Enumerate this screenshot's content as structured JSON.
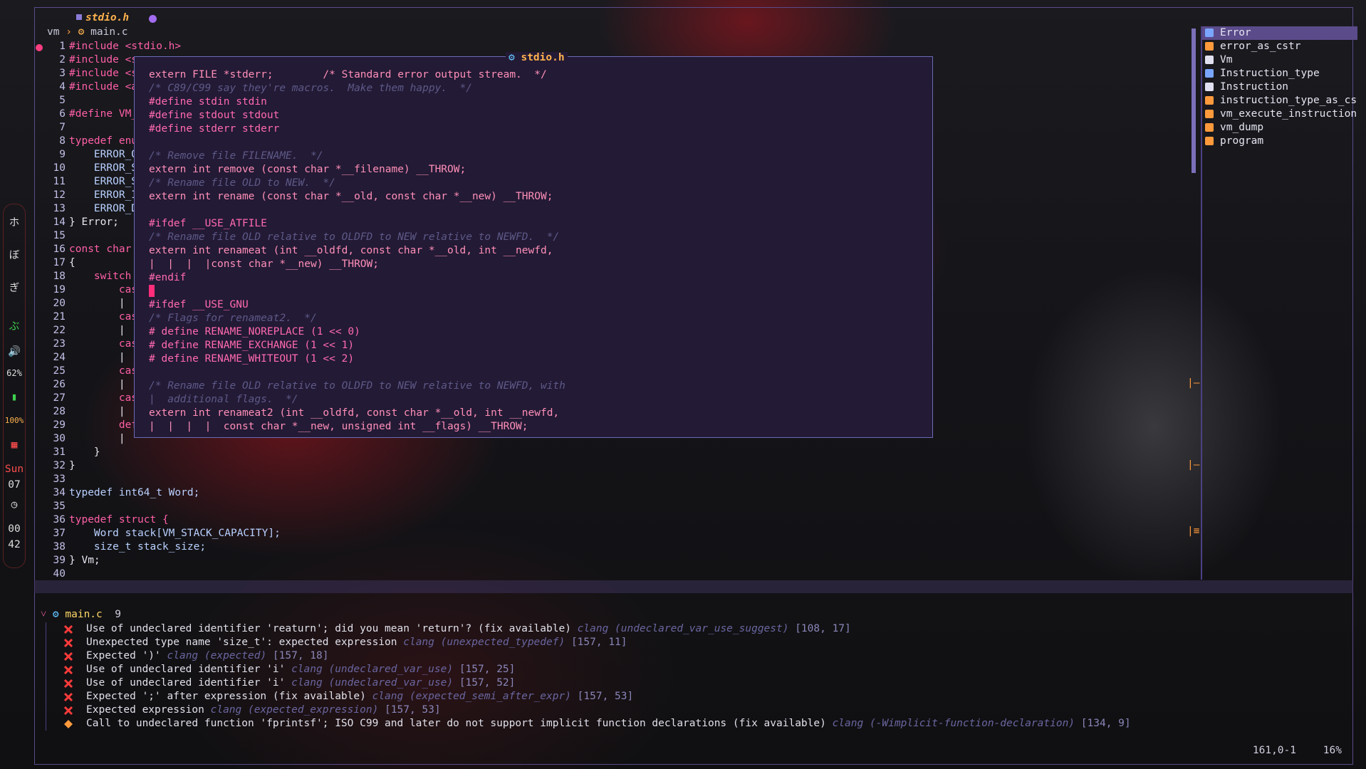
{
  "tabline": {
    "active_tab": "stdio.h"
  },
  "breadcrumb": {
    "root": "vm",
    "file": "main.c"
  },
  "editor": {
    "line_numbers": [
      "1",
      "2",
      "3",
      "4",
      "5",
      "6",
      "7",
      "8",
      "9",
      "10",
      "11",
      "12",
      "13",
      "14",
      "15",
      "16",
      "17",
      "18",
      "19",
      "20",
      "21",
      "22",
      "23",
      "24",
      "25",
      "26",
      "27",
      "28",
      "29",
      "30",
      "31",
      "32",
      "33",
      "34",
      "35",
      "36",
      "37",
      "38",
      "39",
      "40"
    ],
    "lines": [
      "#include <stdio.h>",
      "#include <s",
      "#include <s",
      "#include <a",
      "",
      "#define VM_",
      "",
      "typedef enu",
      "    ERROR_O",
      "    ERROR_S",
      "    ERROR_S",
      "    ERROR_I",
      "    ERROR_D",
      "} Error;",
      "",
      "const char",
      "{",
      "    switch",
      "        cas",
      "        |",
      "        cas",
      "        |",
      "        cas",
      "        |",
      "        cas",
      "        |",
      "        cas",
      "        |",
      "        def",
      "        |",
      "    }",
      "}",
      "",
      "typedef int64_t Word;",
      "",
      "typedef struct {",
      "    Word stack[VM_STACK_CAPACITY];",
      "    size_t stack_size;",
      "} Vm;",
      ""
    ]
  },
  "float": {
    "title": "stdio.h",
    "lines": [
      "extern FILE *stderr;        /* Standard error output stream.  */",
      "/* C89/C99 say they're macros.  Make them happy.  */",
      "#define stdin stdin",
      "#define stdout stdout",
      "#define stderr stderr",
      "",
      "/* Remove file FILENAME.  */",
      "extern int remove (const char *__filename) __THROW;",
      "/* Rename file OLD to NEW.  */",
      "extern int rename (const char *__old, const char *__new) __THROW;",
      "",
      "#ifdef __USE_ATFILE",
      "/* Rename file OLD relative to OLDFD to NEW relative to NEWFD.  */",
      "extern int renameat (int __oldfd, const char *__old, int __newfd,",
      "|  |  |  |const char *__new) __THROW;",
      "#endif",
      "",
      "#ifdef __USE_GNU",
      "/* Flags for renameat2.  */",
      "# define RENAME_NOREPLACE (1 << 0)",
      "# define RENAME_EXCHANGE (1 << 1)",
      "# define RENAME_WHITEOUT (1 << 2)",
      "",
      "/* Rename file OLD relative to OLDFD to NEW relative to NEWFD, with",
      "|  additional flags.  */",
      "extern int renameat2 (int __oldfd, const char *__old, int __newfd,",
      "|  |  |  |  const char *__new, unsigned int __flags) __THROW;"
    ]
  },
  "rail": {
    "items": [
      "ホ",
      "ぼ",
      "ぎ",
      "ぶ"
    ],
    "volume": "62%",
    "battery": "100%",
    "day": "Sun",
    "date": "07",
    "hour": "00",
    "minute": "42"
  },
  "outline": {
    "items": [
      {
        "label": "Error",
        "icon": "enum-icon",
        "color": "#7aa6ff"
      },
      {
        "label": "error_as_cstr",
        "icon": "function-icon",
        "color": "#ff9a3c"
      },
      {
        "label": "Vm",
        "icon": "struct-icon",
        "color": "#e0e0f0"
      },
      {
        "label": "Instruction_type",
        "icon": "enum-icon",
        "color": "#7aa6ff"
      },
      {
        "label": "Instruction",
        "icon": "struct-icon",
        "color": "#e0e0f0"
      },
      {
        "label": "instruction_type_as_cstr",
        "icon": "function-icon",
        "color": "#ff9a3c"
      },
      {
        "label": "vm_execute_instruction",
        "icon": "function-icon",
        "color": "#ff9a3c"
      },
      {
        "label": "vm_dump",
        "icon": "function-icon",
        "color": "#ff9a3c"
      },
      {
        "label": "program",
        "icon": "function-icon",
        "color": "#ff9a3c"
      }
    ]
  },
  "diagnostics": {
    "file": "main.c",
    "count": "9",
    "items": [
      {
        "severity": "error",
        "message": "Use of undeclared identifier 'reaturn'; did you mean 'return'? (fix available)",
        "source": "clang (undeclared_var_use_suggest)",
        "pos": "[108, 17]"
      },
      {
        "severity": "error",
        "message": "Unexpected type name 'size_t': expected expression",
        "source": "clang (unexpected_typedef)",
        "pos": "[157, 11]"
      },
      {
        "severity": "error",
        "message": "Expected ')'",
        "source": "clang (expected)",
        "pos": "[157, 18]"
      },
      {
        "severity": "error",
        "message": "Use of undeclared identifier 'i'",
        "source": "clang (undeclared_var_use)",
        "pos": "[157, 25]"
      },
      {
        "severity": "error",
        "message": "Use of undeclared identifier 'i'",
        "source": "clang (undeclared_var_use)",
        "pos": "[157, 52]"
      },
      {
        "severity": "error",
        "message": "Expected ';' after expression (fix available)",
        "source": "clang (expected_semi_after_expr)",
        "pos": "[157, 53]"
      },
      {
        "severity": "error",
        "message": "Expected expression",
        "source": "clang (expected_expression)",
        "pos": "[157, 53]"
      },
      {
        "severity": "warning",
        "message": "Call to undeclared function 'fprintsf'; ISO C99 and later do not support implicit function declarations (fix available)",
        "source": "clang (-Wimplicit-function-declaration)",
        "pos": "[134, 9]"
      }
    ]
  },
  "statusline": {
    "cursor_pos": "161,0-1",
    "scroll_percent": "16%"
  },
  "colors": {
    "accent": "#5b4b8a",
    "error": "#ff3b3b",
    "warning": "#ff9a3c",
    "title": "#ffb24d"
  }
}
